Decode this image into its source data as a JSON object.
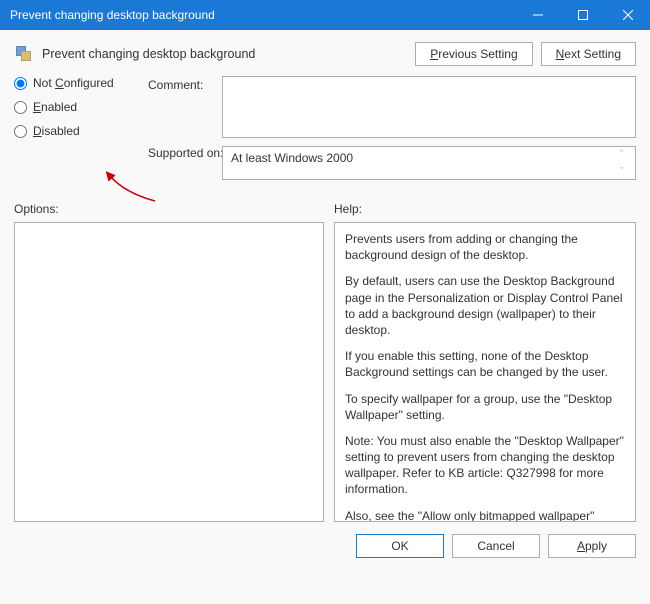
{
  "titlebar": {
    "title": "Prevent changing desktop background"
  },
  "header": {
    "policy_name": "Prevent changing desktop background",
    "prev_label": "Previous Setting",
    "prev_hk": "P",
    "next_label": "Next Setting",
    "next_hk": "N"
  },
  "config": {
    "radios": {
      "not_configured": "Not Configured",
      "not_configured_hk": "C",
      "enabled": "Enabled",
      "enabled_hk": "E",
      "disabled": "Disabled",
      "disabled_hk": "D",
      "selected": "not_configured"
    },
    "comment_label": "Comment:",
    "comment_value": "",
    "supported_label": "Supported on:",
    "supported_value": "At least Windows 2000"
  },
  "panes": {
    "options_label": "Options:",
    "help_label": "Help:",
    "help_paragraphs": [
      "Prevents users from adding or changing the background design of the desktop.",
      "By default, users can use the Desktop Background page in the Personalization or Display Control Panel to add a background design (wallpaper) to their desktop.",
      "If you enable this setting, none of the Desktop Background settings can be changed by the user.",
      "To specify wallpaper for a group, use the \"Desktop Wallpaper\" setting.",
      "Note: You must also enable the \"Desktop Wallpaper\" setting to prevent users from changing the desktop wallpaper. Refer to KB article: Q327998 for more information.",
      "Also, see the \"Allow only bitmapped wallpaper\" setting."
    ]
  },
  "footer": {
    "ok": "OK",
    "cancel": "Cancel",
    "apply": "Apply",
    "apply_hk": "A"
  }
}
